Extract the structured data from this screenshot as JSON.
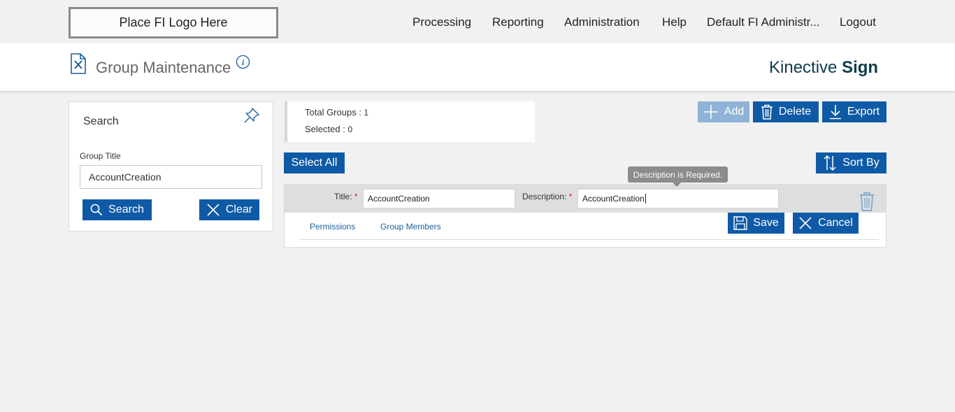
{
  "logo": {
    "text": "Place FI Logo Here"
  },
  "nav": {
    "items": [
      "Processing",
      "Reporting",
      "Administration",
      "Help",
      "Default FI Administr...",
      "Logout"
    ]
  },
  "header": {
    "title": "Group Maintenance",
    "brand_regular": "Kinective ",
    "brand_bold": "Sign",
    "icons": {
      "page": "document-tools-icon",
      "info": "info-icon"
    }
  },
  "search": {
    "heading": "Search",
    "group_title_label": "Group Title",
    "group_title_value": "AccountCreation",
    "search_button": "Search",
    "clear_button": "Clear",
    "icons": {
      "pin": "pin-icon",
      "search": "search-icon",
      "clear": "close-icon"
    }
  },
  "counts": {
    "total_label": "Total Groups : ",
    "total_value": "1",
    "selected_label": "Selected : ",
    "selected_value": "0"
  },
  "toolbar": {
    "add": "Add",
    "delete": "Delete",
    "export": "Export",
    "select_all": "Select All",
    "sort_by": "Sort By",
    "add_disabled": true
  },
  "edit_row": {
    "title_label": "Title:",
    "title_value": "AccountCreation",
    "description_label": "Description:",
    "description_value": "AccountCreation",
    "required_marker": "*",
    "tooltip": "Description is Required.",
    "tabs": [
      "Permissions",
      "Group Members"
    ],
    "save": "Save",
    "cancel": "Cancel"
  },
  "colors": {
    "primary_button": "#0f5aa6",
    "disabled_button": "#8fb3d6",
    "brand_text": "#0f3b4d",
    "link": "#1b5e9e",
    "required": "#d3202a"
  }
}
